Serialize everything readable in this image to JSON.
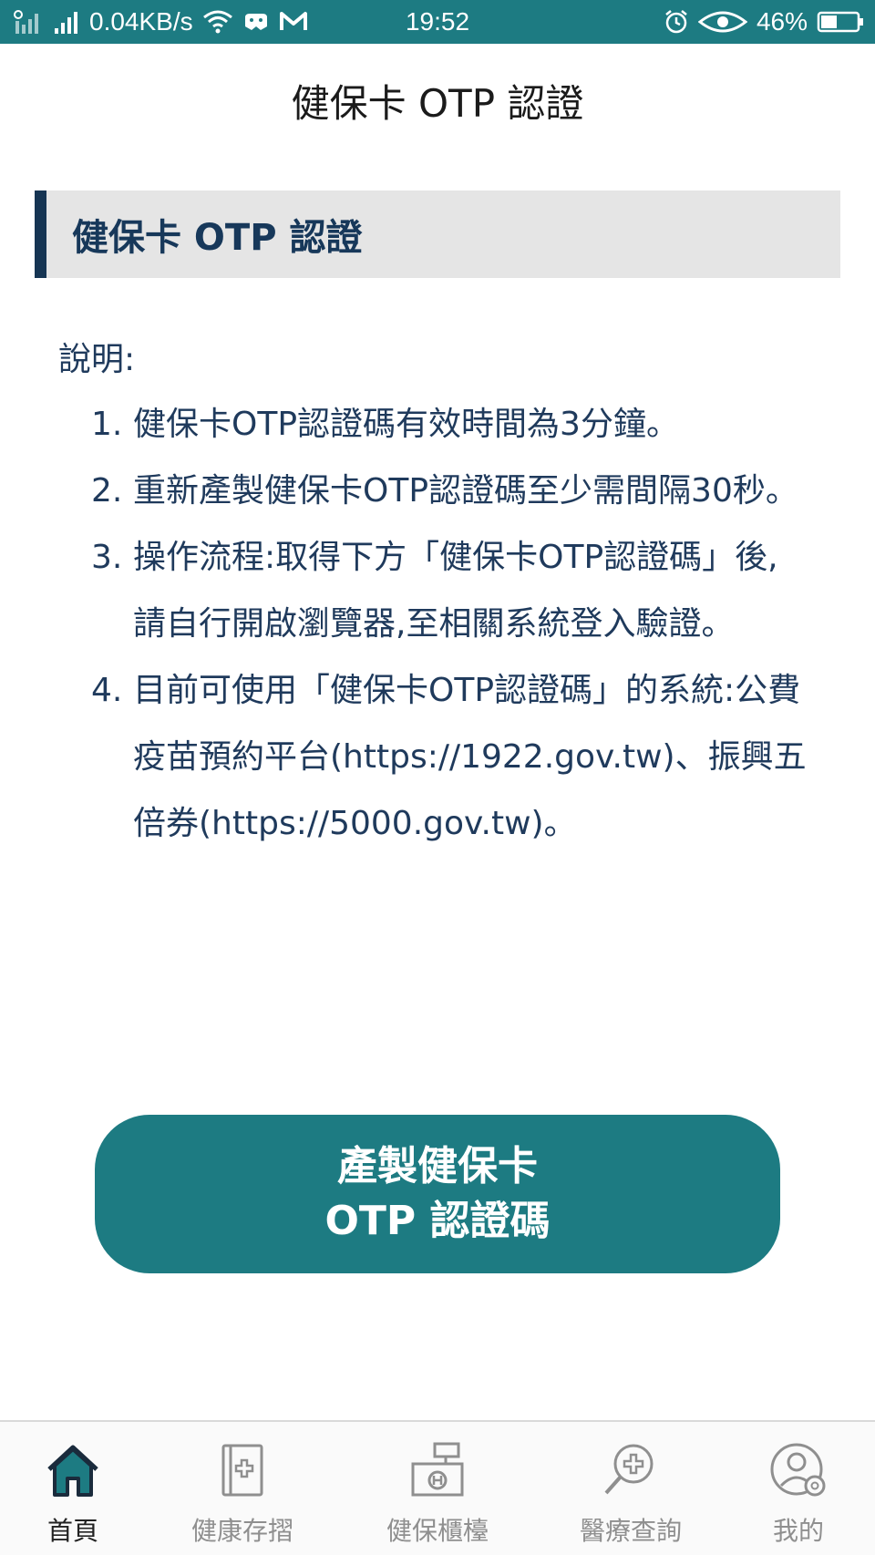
{
  "status_bar": {
    "network_speed": "0.04KB/s",
    "time": "19:52",
    "battery": "46%",
    "battery_level": 0.46,
    "icons": [
      "signal-icon",
      "signal-icon",
      "wifi-icon",
      "game-icon",
      "mail-icon",
      "alarm-icon",
      "eye-icon",
      "battery-icon"
    ]
  },
  "header": {
    "title": "健保卡 OTP 認證"
  },
  "section": {
    "title": "健保卡 OTP 認證"
  },
  "description": {
    "label": "說明:",
    "items": [
      {
        "num": "1.",
        "text": "健保卡OTP認證碼有效時間為3分鐘。"
      },
      {
        "num": "2.",
        "text": "重新產製健保卡OTP認證碼至少需間隔30秒。"
      },
      {
        "num": "3.",
        "text": "操作流程:取得下方「健保卡OTP認證碼」後,請自行開啟瀏覽器,至相關系統登入驗證。"
      },
      {
        "num": "4.",
        "text": "目前可使用「健保卡OTP認證碼」的系統:公費疫苗預約平台(https://1922.gov.tw)、振興五倍券(https://5000.gov.tw)。"
      }
    ]
  },
  "action": {
    "button_line1": "產製健保卡",
    "button_line2": "OTP 認證碼"
  },
  "bottom_nav": {
    "items": [
      {
        "label": "首頁",
        "icon": "home-icon",
        "active": true
      },
      {
        "label": "健康存摺",
        "icon": "health-book-icon",
        "active": false
      },
      {
        "label": "健保櫃檯",
        "icon": "counter-icon",
        "active": false
      },
      {
        "label": "醫療查詢",
        "icon": "medical-search-icon",
        "active": false
      },
      {
        "label": "我的",
        "icon": "profile-settings-icon",
        "active": false
      }
    ]
  },
  "colors": {
    "primary": "#1d7b82",
    "section_accent": "#163553",
    "text": "#1f3a5c",
    "inactive": "#8f8f8f"
  }
}
